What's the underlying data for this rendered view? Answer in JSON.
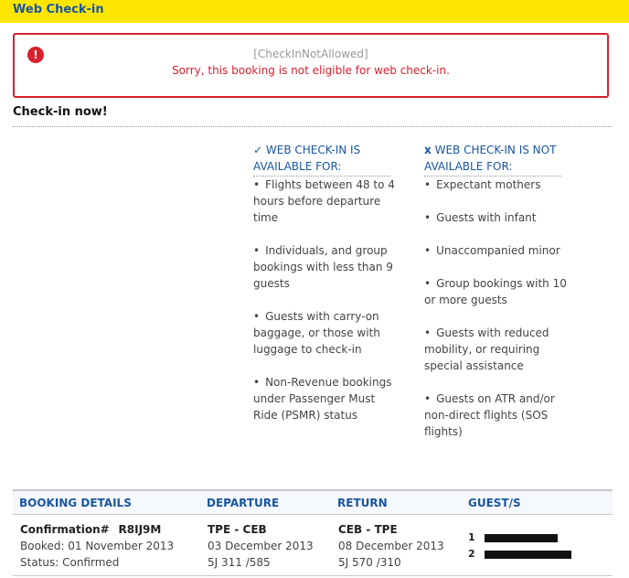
{
  "header": {
    "title": "Web Check-in"
  },
  "error": {
    "icon": "exclamation-icon",
    "code": "[CheckInNotAllowed]",
    "message": "Sorry, this booking is not eligible for web check-in.",
    "color": "#d9202d"
  },
  "section": {
    "title": "Check-in now!"
  },
  "available": {
    "mark": "✓",
    "heading": "WEB CHECK-IN IS AVAILABLE FOR:",
    "items": [
      "Flights between 48 to 4 hours before departure time",
      "Individuals, and group bookings with less than 9 guests",
      "Guests with carry-on baggage, or those with luggage to check-in",
      "Non-Revenue bookings under Passenger Must Ride (PSMR) status"
    ]
  },
  "not_available": {
    "mark": "x",
    "heading": "WEB CHECK-IN IS NOT AVAILABLE FOR:",
    "items": [
      "Expectant mothers",
      "Guests with infant",
      "Unaccompanied minor",
      "Group bookings with 10 or more guests",
      "Guests with reduced mobility, or requiring special assistance",
      "Guests on ATR and/or non-direct flights (SOS flights)"
    ]
  },
  "booking": {
    "headers": {
      "details": "BOOKING DETAILS",
      "departure": "DEPARTURE",
      "return": "RETURN",
      "guests": "GUEST/S"
    },
    "confirmation_label": "Confirmation#",
    "confirmation_code": "R8IJ9M",
    "booked": "Booked: 01 November 2013",
    "status": "Status: Confirmed",
    "departure": {
      "route": "TPE - CEB",
      "date": "03 December 2013",
      "flight": "5J 311 /585"
    },
    "return": {
      "route": "CEB - TPE",
      "date": "08 December 2013",
      "flight": "5J 570 /310"
    },
    "guests": [
      {
        "number": "1"
      },
      {
        "number": "2"
      }
    ]
  },
  "colors": {
    "brand_yellow": "#ffe500",
    "link_blue": "#1a56a0"
  }
}
